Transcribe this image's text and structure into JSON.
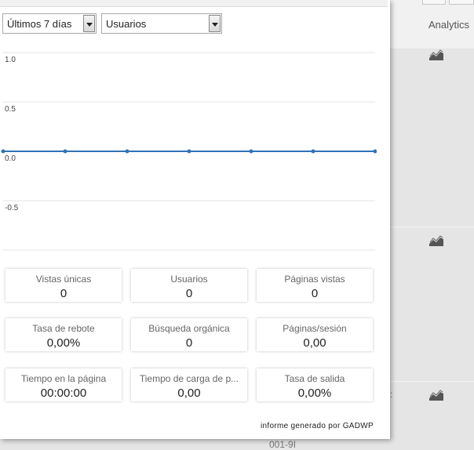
{
  "background": {
    "column_header": "Analytics",
    "row_fragments": [
      ":",
      "001-9I"
    ]
  },
  "controls": {
    "period": "Últimos 7 días",
    "metric": "Usuarios"
  },
  "chart_data": {
    "type": "line",
    "x": [
      0,
      1,
      2,
      3,
      4,
      5,
      6
    ],
    "series": [
      {
        "values": [
          0,
          0,
          0,
          0,
          0,
          0,
          0
        ],
        "color": "#2f72b7"
      }
    ],
    "y_ticks": [
      "1.0",
      "0.5",
      "0.0",
      "-0.5"
    ],
    "ylim": [
      -1.0,
      1.0
    ],
    "grid": true
  },
  "stats": [
    {
      "label": "Vistas únicas",
      "value": "0"
    },
    {
      "label": "Usuarios",
      "value": "0"
    },
    {
      "label": "Páginas vistas",
      "value": "0"
    },
    {
      "label": "Tasa de rebote",
      "value": "0,00%"
    },
    {
      "label": "Búsqueda orgánica",
      "value": "0"
    },
    {
      "label": "Páginas/sesión",
      "value": "0,00"
    },
    {
      "label": "Tiempo en la página",
      "value": "00:00:00"
    },
    {
      "label": "Tiempo de carga de p...",
      "value": "0,00"
    },
    {
      "label": "Tasa de salida",
      "value": "0,00%"
    }
  ],
  "footer": "informe generado por GADWP"
}
